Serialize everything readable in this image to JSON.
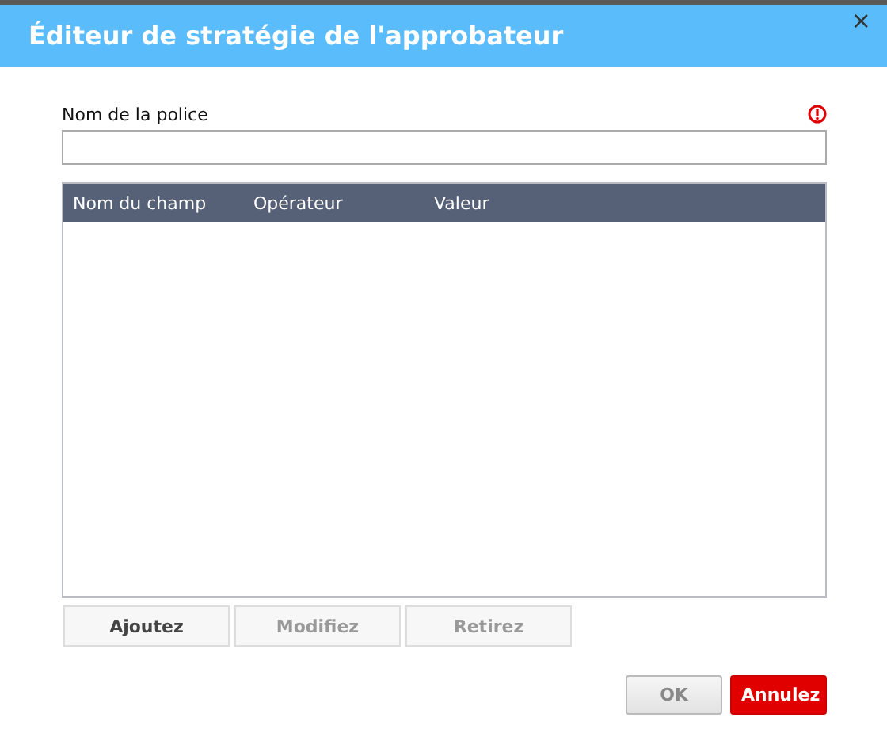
{
  "window": {
    "title": "Éditeur de stratégie de l'approbateur",
    "close": "×"
  },
  "policy_name": {
    "label": "Nom de la police",
    "required_error": true
  },
  "table": {
    "columns": [
      "Nom du champ",
      "Opérateur",
      "Valeur"
    ]
  },
  "row_buttons": [
    {
      "label": "Ajoutez",
      "disabled": false
    },
    {
      "label": "Modifiez",
      "disabled": true
    },
    {
      "label": "Retirez",
      "disabled": true
    }
  ],
  "dialog_buttons": [
    {
      "label": "OK",
      "kind": "secondary",
      "disabled": true
    },
    {
      "label": "Annulez",
      "kind": "danger",
      "disabled": false
    }
  ]
}
